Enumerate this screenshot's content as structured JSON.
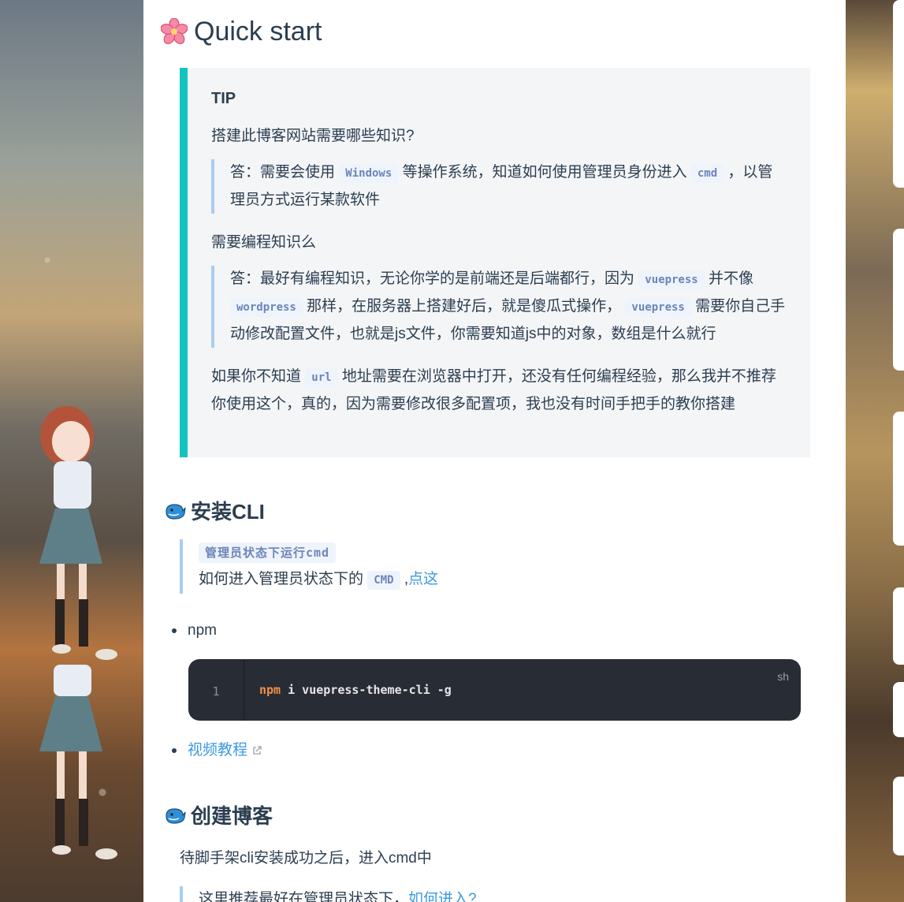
{
  "page": {
    "title": "Quick start",
    "tip": {
      "title": "TIP",
      "q1": "搭建此博客网站需要哪些知识?",
      "a1_parts": [
        "答：需要会使用 ",
        "Windows",
        " 等操作系统，知道如何使用管理员身份进入 ",
        "cmd",
        " ，以管理员方式运行某款软件"
      ],
      "q2": "需要编程知识么",
      "a2_parts": [
        "答：最好有编程知识，无论你学的是前端还是后端都行，因为 ",
        "vuepress",
        " 并不像 ",
        "wordpress",
        " 那样，在服务器上搭建好后，就是傻瓜式操作， ",
        "vuepress",
        " 需要你自己手动修改配置文件，也就是js文件，你需要知道js中的对象，数组是什么就行"
      ],
      "p3_parts": [
        "如果你不知道 ",
        "url",
        " 地址需要在浏览器中打开，还没有任何编程经验，那么我并不推荐你使用这个，真的，因为需要修改很多配置项，我也没有时间手把手的教你搭建"
      ]
    },
    "install": {
      "heading": "安装CLI",
      "quote_code": "管理员状态下运行cmd",
      "quote_text_1": "如何进入管理员状态下的 ",
      "quote_code2": "CMD",
      "quote_text_2": " ,",
      "quote_link": "点这",
      "item_npm": "npm",
      "item_video": "视频教程",
      "code": {
        "lang": "sh",
        "line_no": "1",
        "cmd": "npm",
        "rest": " i vuepress-theme-cli -g"
      }
    },
    "create": {
      "heading": "创建博客",
      "text": "待脚手架cli安装成功之后，进入cmd中",
      "quote_partial": "这里推荐最好在管理员状态下，",
      "quote_link": "如何进入?"
    }
  },
  "colors": {
    "tip_border": "#11c5bf",
    "link": "#3c9ae0",
    "code_bg": "#282c34"
  }
}
